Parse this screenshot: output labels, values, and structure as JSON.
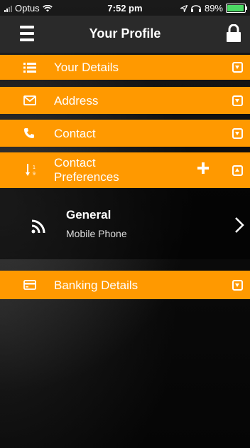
{
  "status_bar": {
    "carrier": "Optus",
    "time": "7:52 pm",
    "battery": "89%",
    "battery_color": "#4cd964"
  },
  "header": {
    "title": "Your Profile",
    "menu_icon": "hamburger-menu-icon",
    "lock_icon": "lock-icon"
  },
  "sections": [
    {
      "label": "Your Details",
      "icon": "list-icon",
      "state": "collapsed"
    },
    {
      "label": "Address",
      "icon": "envelope-icon",
      "state": "collapsed"
    },
    {
      "label": "Contact",
      "icon": "phone-icon",
      "state": "collapsed"
    },
    {
      "label": "Contact Preferences",
      "label_line1": "Contact",
      "label_line2": "Preferences",
      "icon": "sort-numeric-icon",
      "state": "expanded"
    },
    {
      "label": "Banking Details",
      "icon": "credit-card-icon",
      "state": "collapsed"
    }
  ],
  "contact_preferences": {
    "items": [
      {
        "title": "General",
        "subtitle": "Mobile Phone",
        "icon": "rss-icon"
      }
    ]
  },
  "colors": {
    "accent": "#ff9900",
    "header_bg": "#2a2a2a"
  }
}
